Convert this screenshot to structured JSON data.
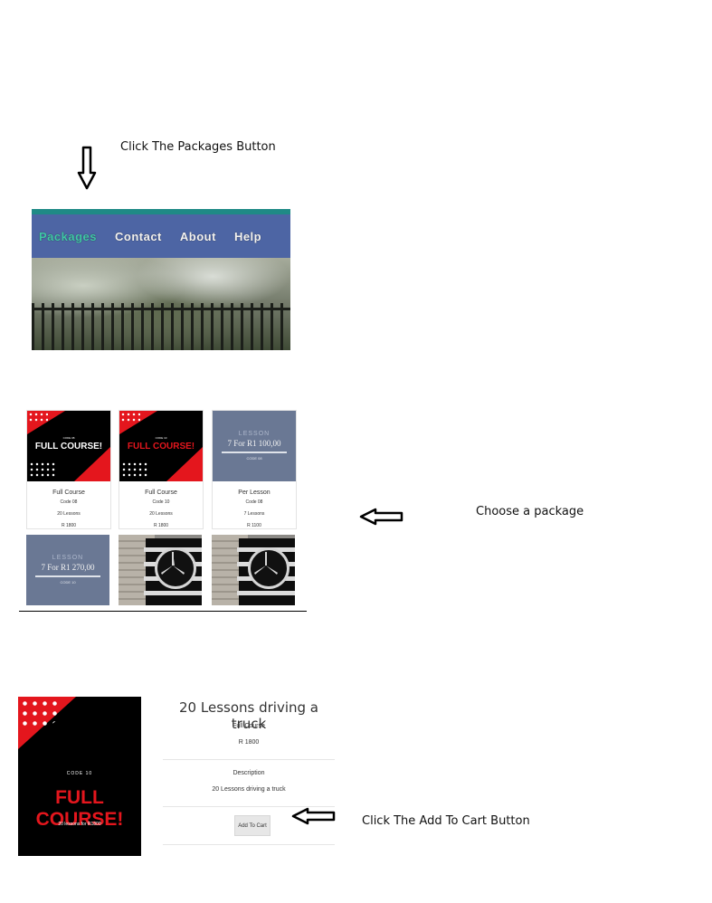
{
  "instructions": {
    "step1": "Click The Packages Button",
    "step2": "Choose a package",
    "step3": "Click The Add To Cart Button"
  },
  "nav": {
    "items": [
      {
        "label": "Packages",
        "active": true
      },
      {
        "label": "Contact",
        "active": false
      },
      {
        "label": "About",
        "active": false
      },
      {
        "label": "Help",
        "active": false
      }
    ],
    "colors": {
      "bar": "#4d65a4",
      "top_strip": "#1f8a86",
      "active_text": "#3fc7a8"
    }
  },
  "packages": [
    {
      "image": {
        "kind": "full-course",
        "heading": "FULL COURSE!",
        "heading_color": "#ffffff",
        "code": "CODE 08"
      },
      "title": "Full Course",
      "code": "Code 08",
      "lessons": "20 Lessons",
      "price": "R 1800"
    },
    {
      "image": {
        "kind": "full-course",
        "heading": "FULL COURSE!",
        "heading_color": "#e4161d",
        "code": "CODE 10"
      },
      "title": "Full Course",
      "code": "Code 10",
      "lessons": "20 Lessons",
      "price": "R 1800"
    },
    {
      "image": {
        "kind": "lesson",
        "heading": "LESSON",
        "price": "7 For R1 100,00",
        "code": "CODE 08"
      },
      "title": "Per Lesson",
      "code": "Code 08",
      "lessons": "7 Lessons",
      "price": "R 1100"
    },
    {
      "image": {
        "kind": "lesson",
        "heading": "LESSON",
        "price": "7 For R1 270,00",
        "code": "CODE 10"
      }
    },
    {
      "image": {
        "kind": "mercedes"
      }
    },
    {
      "image": {
        "kind": "mercedes"
      }
    }
  ],
  "product": {
    "image": {
      "code": "CODE 10",
      "heading": "FULL COURSE!",
      "subtitle": "20 lessons for R1800"
    },
    "title": "20 Lessons driving a truck",
    "category": "Full Course",
    "price": "R 1800",
    "description_label": "Description",
    "description": "20 Lessons driving a truck",
    "add_to_cart_label": "Add To Cart"
  },
  "icons": [
    "down-arrow-icon",
    "left-arrow-icon"
  ]
}
